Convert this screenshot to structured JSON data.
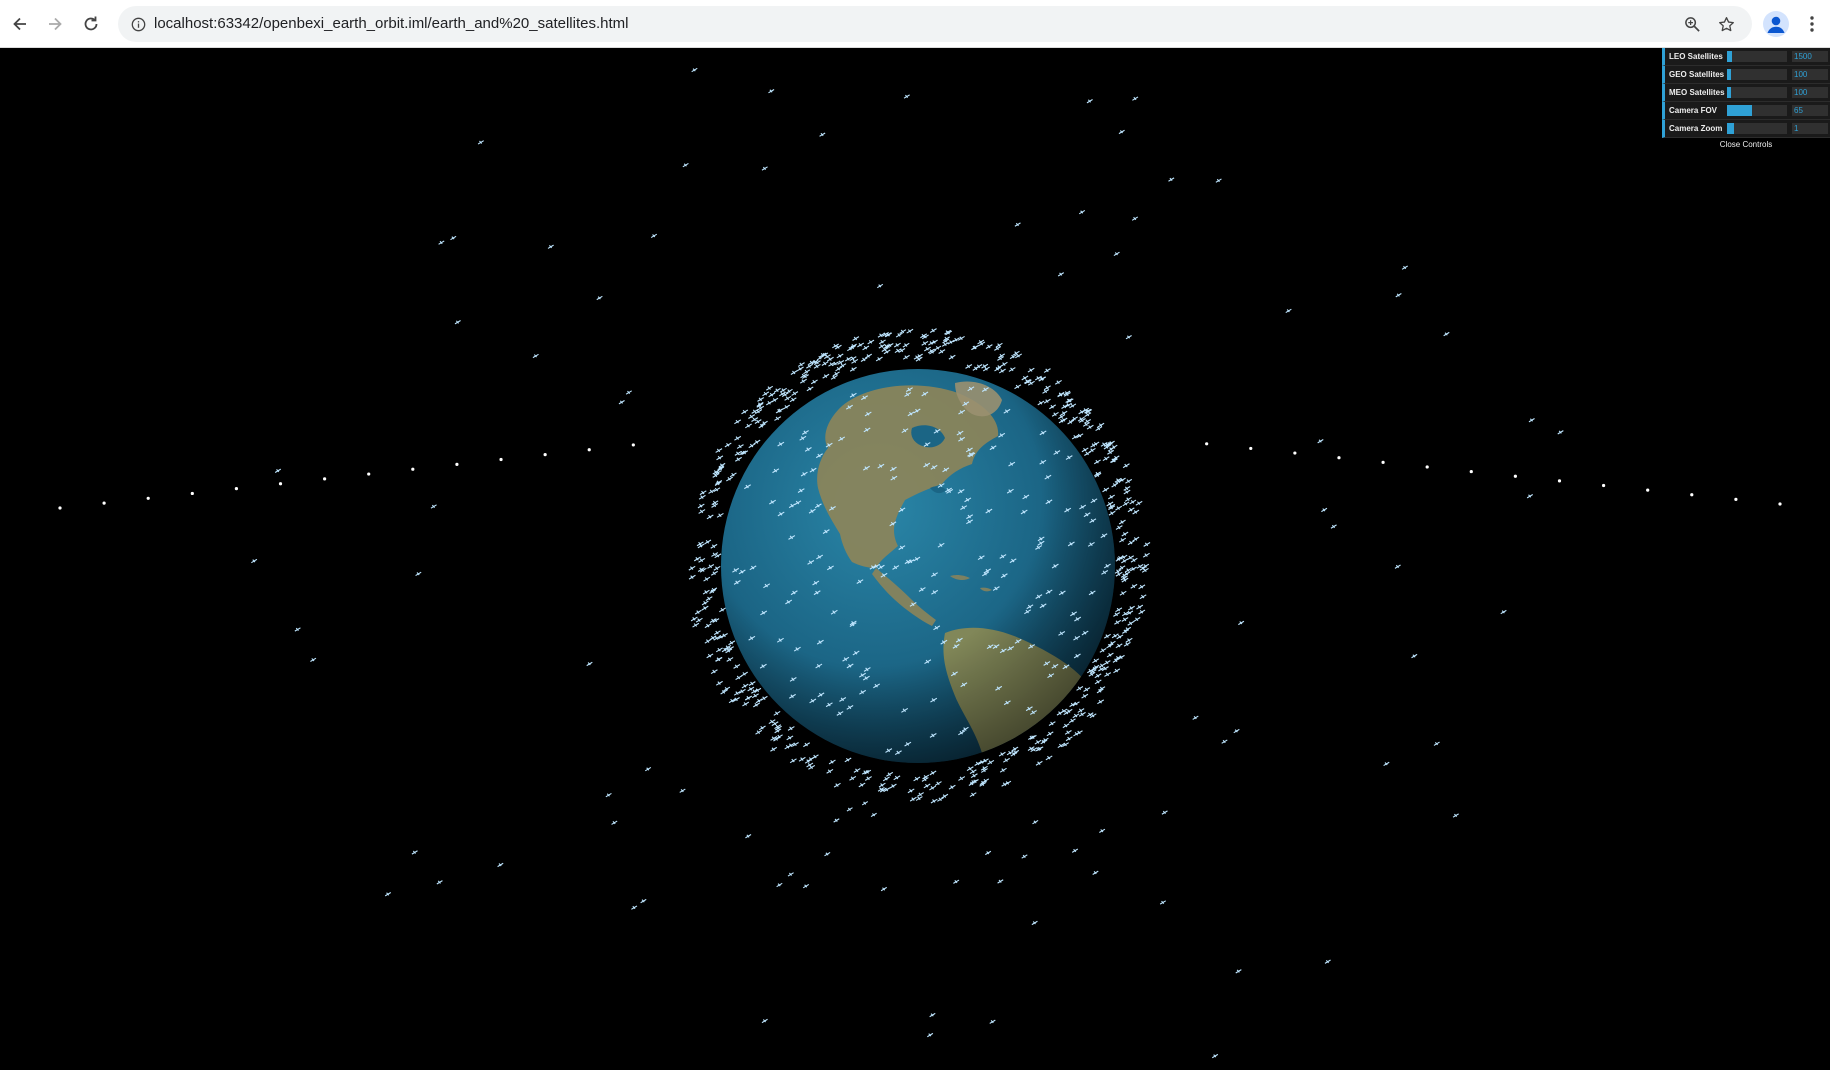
{
  "browser": {
    "url": "localhost:63342/openbexi_earth_orbit.iml/earth_and%20_satellites.html"
  },
  "controls": {
    "items": [
      {
        "label": "LEO Satellites",
        "value": "1500",
        "fraction": 0.08
      },
      {
        "label": "GEO Satellites",
        "value": "100",
        "fraction": 0.06
      },
      {
        "label": "MEO Satellites",
        "value": "100",
        "fraction": 0.06
      },
      {
        "label": "Camera FOV",
        "value": "65",
        "fraction": 0.42
      },
      {
        "label": "Camera Zoom",
        "value": "1",
        "fraction": 0.12
      }
    ],
    "close_label": "Close Controls"
  },
  "colors": {
    "accent": "#2fa1d6",
    "space": "#000000",
    "ocean": "#1f6b8a",
    "land": "#8c8459",
    "satellite": "#bfe6ff"
  }
}
